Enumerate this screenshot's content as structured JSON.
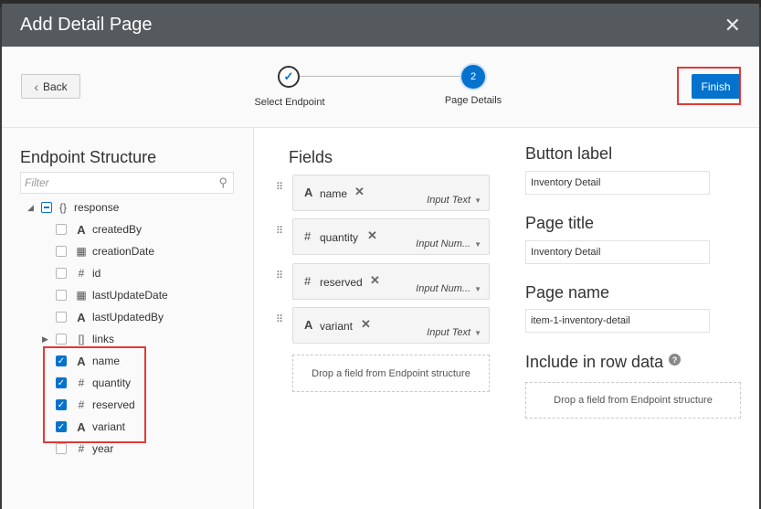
{
  "dialog": {
    "title": "Add Detail Page",
    "close_icon": "close-icon"
  },
  "train": {
    "back_label": "Back",
    "steps": [
      {
        "label": "Select Endpoint",
        "state": "complete",
        "mark": "✓"
      },
      {
        "label": "Page Details",
        "state": "current",
        "mark": "2"
      }
    ],
    "finish_label": "Finish"
  },
  "endpoint": {
    "heading": "Endpoint Structure",
    "filter_placeholder": "Filter",
    "root": {
      "label": "response",
      "icon": "{}"
    },
    "items": [
      {
        "label": "createdBy",
        "icon": "A",
        "checked": false
      },
      {
        "label": "creationDate",
        "icon": "calendar",
        "checked": false
      },
      {
        "label": "id",
        "icon": "#",
        "checked": false
      },
      {
        "label": "lastUpdateDate",
        "icon": "calendar",
        "checked": false
      },
      {
        "label": "lastUpdatedBy",
        "icon": "A",
        "checked": false
      },
      {
        "label": "links",
        "icon": "[]",
        "checked": false
      },
      {
        "label": "name",
        "icon": "A",
        "checked": true
      },
      {
        "label": "quantity",
        "icon": "#",
        "checked": true
      },
      {
        "label": "reserved",
        "icon": "#",
        "checked": true
      },
      {
        "label": "variant",
        "icon": "A",
        "checked": true
      },
      {
        "label": "year",
        "icon": "#",
        "checked": false
      }
    ]
  },
  "fields": {
    "heading": "Fields",
    "items": [
      {
        "name": "name",
        "icon": "A",
        "type": "Input Text"
      },
      {
        "name": "quantity",
        "icon": "#",
        "type": "Input Num..."
      },
      {
        "name": "reserved",
        "icon": "#",
        "type": "Input Num..."
      },
      {
        "name": "variant",
        "icon": "A",
        "type": "Input Text"
      }
    ],
    "dropzone": "Drop a field from Endpoint structure"
  },
  "settings": {
    "button_label_heading": "Button label",
    "button_label_value": "Inventory Detail",
    "page_title_heading": "Page title",
    "page_title_value": "Inventory Detail",
    "page_name_heading": "Page name",
    "page_name_value": "item-1-inventory-detail",
    "row_data_heading": "Include in row data",
    "row_data_dropzone": "Drop a field from Endpoint structure"
  },
  "colors": {
    "accent": "#0572ce",
    "titlebar": "#555a5e",
    "highlight": "#e03a3a"
  }
}
